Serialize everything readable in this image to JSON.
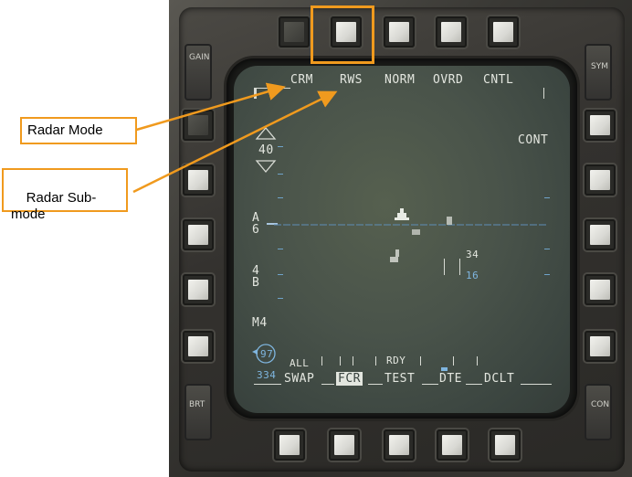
{
  "mfd": {
    "top_menu": [
      "CRM",
      "RWS",
      "NORM",
      "OVRD",
      "CNTL"
    ],
    "right_label": "CONT",
    "left_rocker_top": "GAIN",
    "right_rocker_top": "SYM",
    "left_rocker_bottom": "BRT",
    "right_rocker_bottom": "CON",
    "range": "40",
    "azimuth_label": "A\n6",
    "bar_label": "4\nB",
    "mode_m": "M4",
    "altitude_top": "34",
    "altitude_bottom": "16",
    "heading_top": "97",
    "heading_bottom": "334",
    "bottom_menu": {
      "all": "ALL",
      "swap": "SWAP",
      "fcr": "FCR",
      "rdy": "RDY",
      "test": "TEST",
      "dte": "DTE",
      "dclt": "DCLT"
    }
  },
  "annotations": {
    "radar_mode": "Radar Mode",
    "radar_submode": "Radar Sub-\nmode"
  },
  "colors": {
    "annotation": "#f09a1e",
    "mfd_text": "#e3e6df",
    "mfd_cyan": "#7fb6e0"
  }
}
